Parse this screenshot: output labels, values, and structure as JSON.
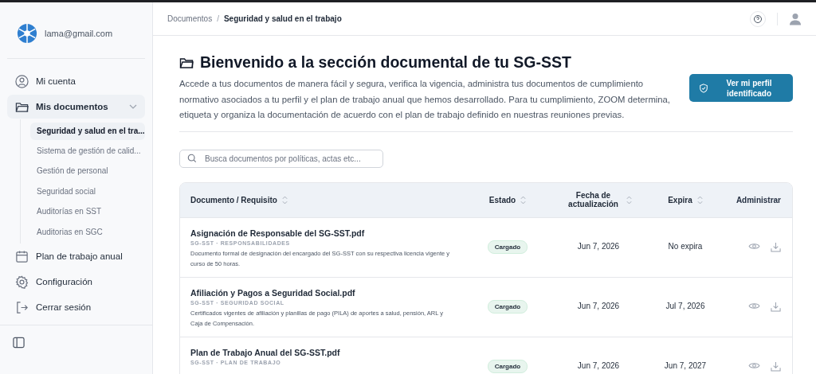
{
  "sidebar": {
    "account_email": "lama@gmail.com",
    "items": [
      {
        "label": "Mi cuenta",
        "kind": "user",
        "selected": false
      },
      {
        "label": "Mis documentos",
        "kind": "folder",
        "selected": true,
        "expanded": true,
        "children": [
          {
            "label": "Seguridad y salud en el tra...",
            "selected": true
          },
          {
            "label": "Sistema de gestión de calid...",
            "selected": false
          },
          {
            "label": "Gestión de personal",
            "selected": false
          },
          {
            "label": "Seguridad social",
            "selected": false
          },
          {
            "label": "Auditorías en SST",
            "selected": false
          },
          {
            "label": "Auditorias en SGC",
            "selected": false
          }
        ]
      },
      {
        "label": "Plan de trabajo anual",
        "kind": "calendar",
        "selected": false
      },
      {
        "label": "Configuración",
        "kind": "gear",
        "selected": false
      },
      {
        "label": "Cerrar sesión",
        "kind": "logout",
        "selected": false
      }
    ]
  },
  "breadcrumb": {
    "separator": "/",
    "items": [
      "Documentos",
      "Seguridad y salud en el trabajo"
    ]
  },
  "header": {
    "title": "Bienvenido a la sección documental de tu SG-SST",
    "description": "Accede a tus documentos de manera fácil y segura, verifica la vigencia, administra tus documentos de cumplimiento normativo asociados a tu perfil y el plan de trabajo anual que hemos desarrollado. Para tu cumplimiento, ZOOM determina, etiqueta y organiza la documentación de acuerdo con el plan de trabajo definido en nuestras reuniones previas.",
    "profile_button": "Ver mi perfil identificado"
  },
  "search": {
    "placeholder": "Busca documentos por políticas, actas etc..."
  },
  "table": {
    "columns": [
      {
        "label": "Documento / Requisito",
        "sortable": true
      },
      {
        "label": "Estado",
        "sortable": true
      },
      {
        "label": "Fecha de actualización",
        "sortable": true
      },
      {
        "label": "Expira",
        "sortable": true
      },
      {
        "label": "Administrar",
        "sortable": false
      }
    ],
    "rows": [
      {
        "name": "Asignación de Responsable del SG-SST.pdf",
        "category": "SG-SST · RESPONSABILIDADES",
        "description": "Documento formal de designación del encargado del SG-SST con su respectiva licencia vigente y curso de 50 horas.",
        "status": "Cargado",
        "updated": "Jun 7, 2026",
        "expires": "No expira"
      },
      {
        "name": "Afiliación y Pagos a Seguridad Social.pdf",
        "category": "SG-SST · SEGURIDAD SOCIAL",
        "description": "Certificados vigentes de afiliación y planillas de pago (PILA) de aportes a salud, pensión, ARL y Caja de Compensación.",
        "status": "Cargado",
        "updated": "Jun 7, 2026",
        "expires": "Jul 7, 2026"
      },
      {
        "name": "Plan de Trabajo Anual del SG-SST.pdf",
        "category": "SG-SST · PLAN DE TRABAJO",
        "status": "Cargado",
        "updated": "Jun 7, 2026",
        "expires": "Jun 7, 2027"
      }
    ]
  }
}
